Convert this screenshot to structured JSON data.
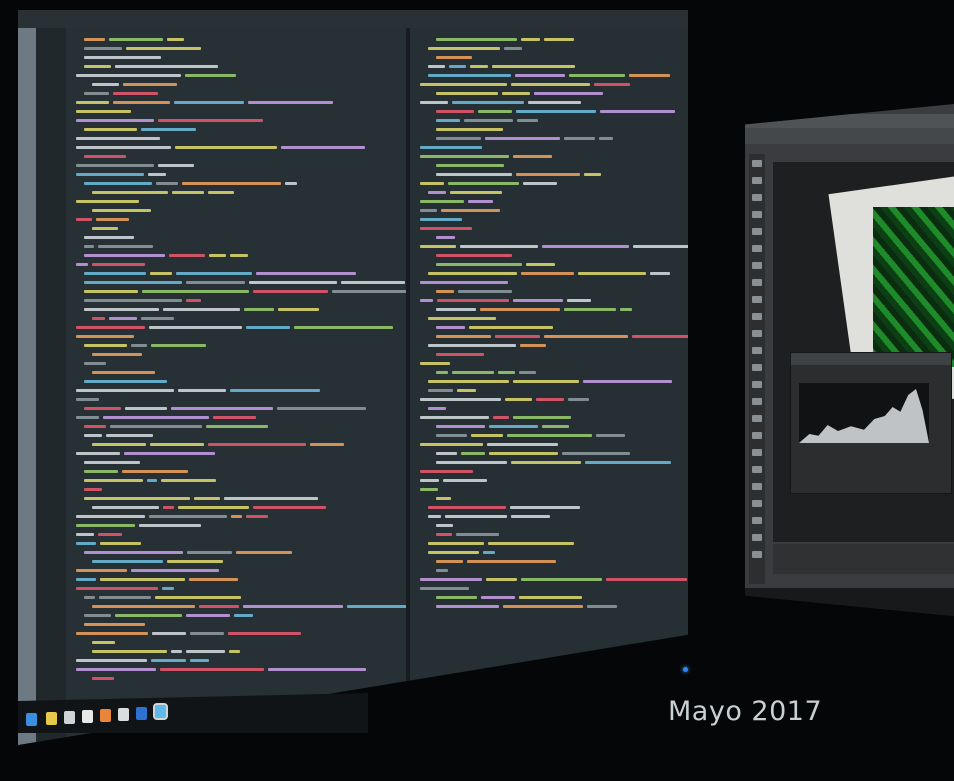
{
  "caption": "Mayo 2017",
  "scene": {
    "left_monitor": "code-editor",
    "right_monitor": "image-editor"
  },
  "colors": {
    "background": "#050608",
    "editor_bg": "#263035",
    "caption_text": "#c9d0d2",
    "power_led": "#2a86ff"
  }
}
